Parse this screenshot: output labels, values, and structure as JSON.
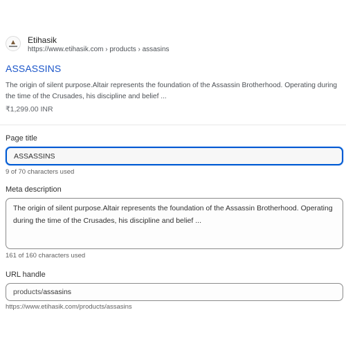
{
  "preview": {
    "site_name": "Etihasik",
    "site_url": "https://www.etihasik.com › products › assasins",
    "title": "ASSASSINS",
    "description": "The origin of silent purpose.Altair represents the foundation of the Assassin Brotherhood. Operating during the time of the Crusades, his discipline and belief ...",
    "price": "₹1,299.00 INR",
    "favicon_icon": "brand-logo-icon",
    "title_color": "#1a55c9"
  },
  "form": {
    "page_title": {
      "label": "Page title",
      "value": "ASSASSINS",
      "help": "9 of 70 characters used"
    },
    "meta_description": {
      "label": "Meta description",
      "value": "The origin of silent purpose.Altair represents the foundation of the Assassin Brotherhood. Operating during the time of the Crusades, his discipline and belief ...",
      "help": "161 of 160 characters used"
    },
    "url_handle": {
      "label": "URL handle",
      "prefix": "products/",
      "value": "assasins",
      "help": "https://www.etihasik.com/products/assasins"
    }
  },
  "colors": {
    "focus_ring": "#005bd3",
    "link_blue": "#1a55c9"
  }
}
